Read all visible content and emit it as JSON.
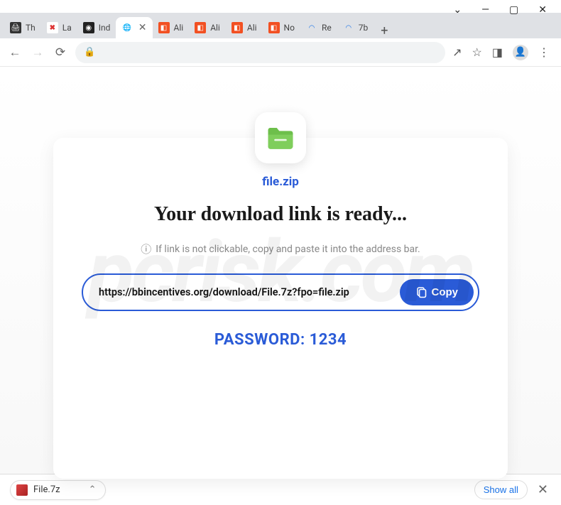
{
  "window": {
    "tabs": [
      {
        "label": "Th",
        "favicon_bg": "#333",
        "favicon_glyph": "🖨"
      },
      {
        "label": "La",
        "favicon_bg": "#d33",
        "favicon_glyph": "✖"
      },
      {
        "label": "Ind",
        "favicon_bg": "#222",
        "favicon_glyph": "◉"
      },
      {
        "label": "",
        "active": true,
        "favicon_bg": "#888",
        "favicon_glyph": "🌐"
      },
      {
        "label": "Ali",
        "favicon_bg": "#f25022",
        "favicon_glyph": "◧"
      },
      {
        "label": "Ali",
        "favicon_bg": "#f25022",
        "favicon_glyph": "◧"
      },
      {
        "label": "Ali",
        "favicon_bg": "#f25022",
        "favicon_glyph": "◧"
      },
      {
        "label": "No",
        "favicon_bg": "#f25022",
        "favicon_glyph": "◧"
      },
      {
        "label": "Re",
        "favicon_bg": "#fff",
        "favicon_glyph": "◠",
        "loading": true
      },
      {
        "label": "7b",
        "favicon_bg": "#fff",
        "favicon_glyph": "◠",
        "loading": true
      }
    ]
  },
  "toolbar": {
    "url": ""
  },
  "page": {
    "file_name": "file.zip",
    "heading": "Your download link is ready...",
    "hint": "If link is not clickable, copy and paste it into the address bar.",
    "download_url": "https://bbincentives.org/download/File.7z?fpo=file.zip",
    "copy_label": "Copy",
    "password_label": "PASSWORD: 1234"
  },
  "downloads": {
    "item_name": "File.7z",
    "show_all_label": "Show all"
  },
  "watermark": "pcrisk.com"
}
